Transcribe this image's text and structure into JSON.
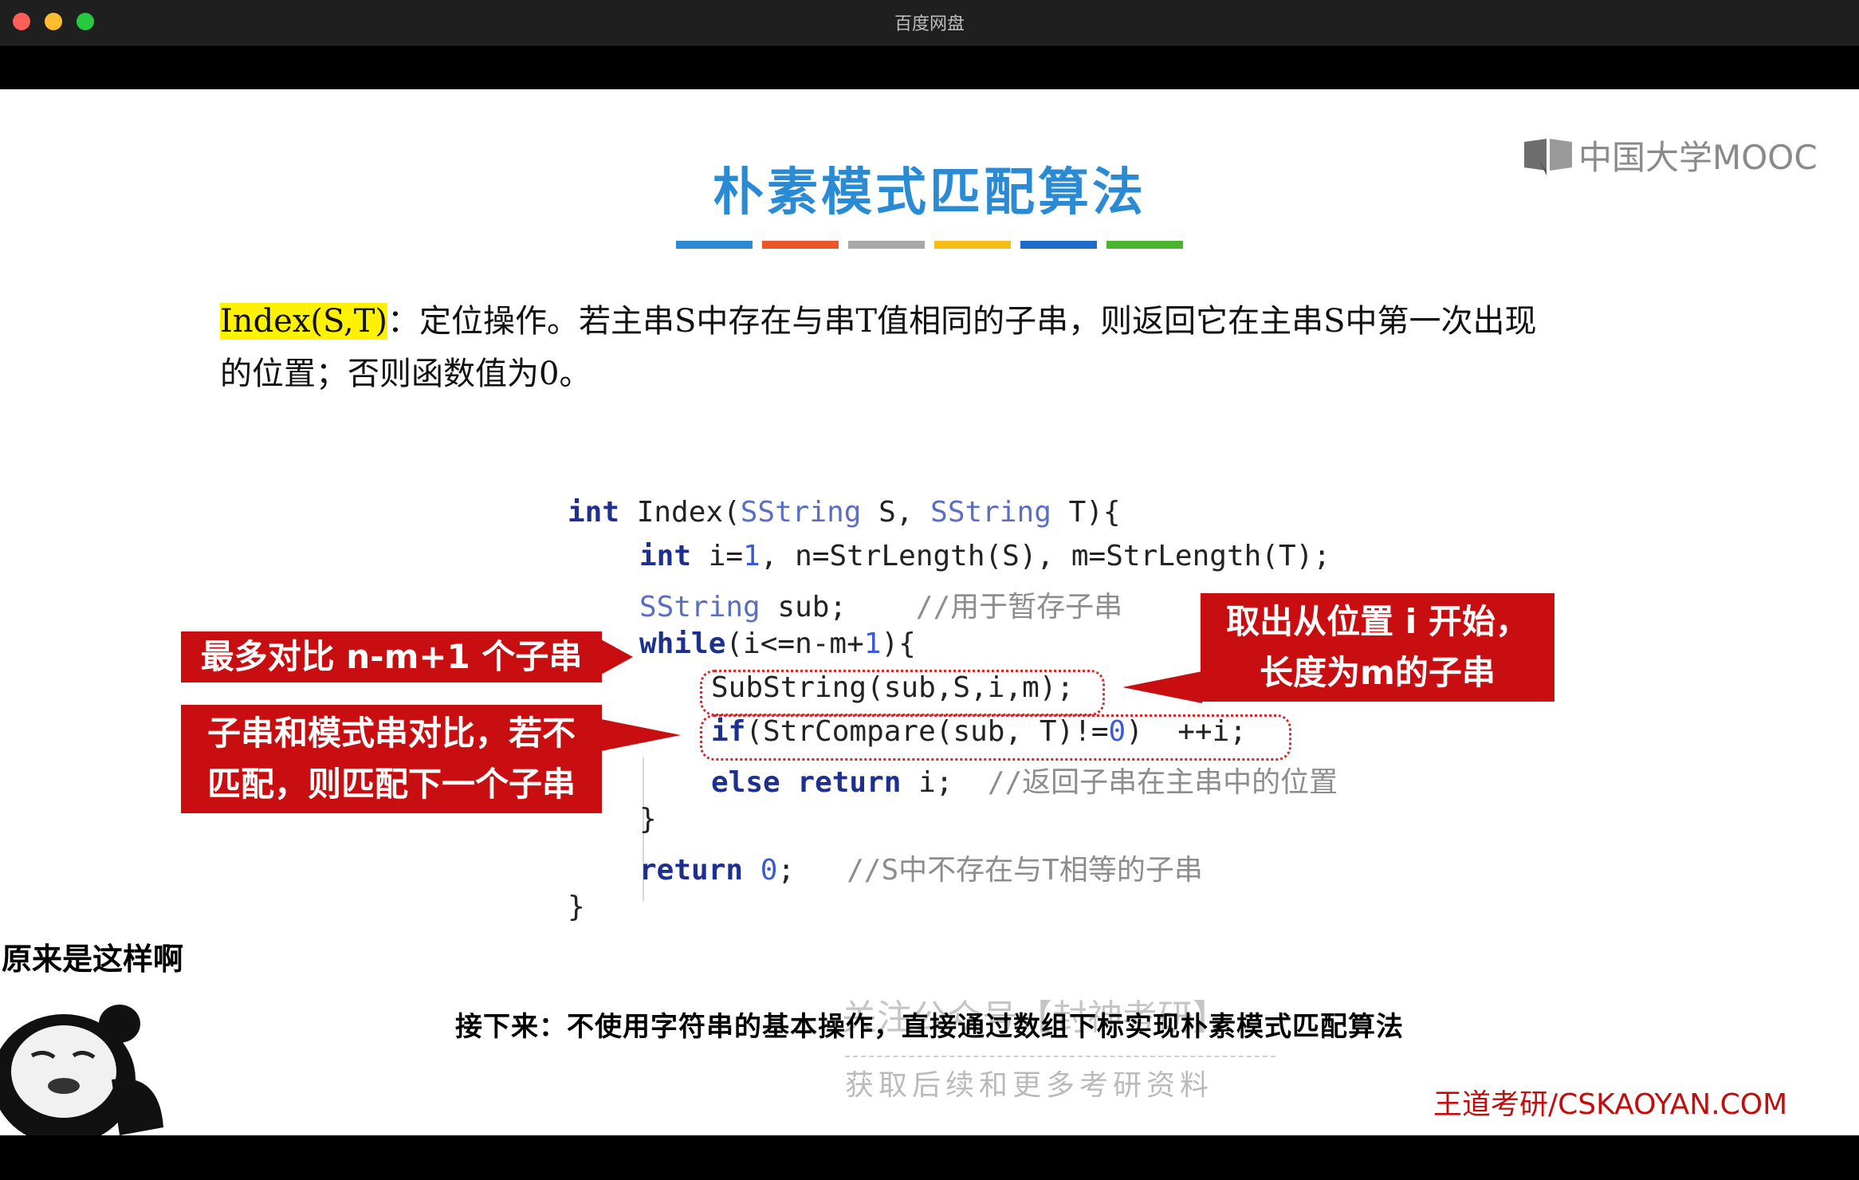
{
  "window": {
    "title": "百度网盘"
  },
  "slide": {
    "logo_text": "中国大学MOOC",
    "title": "朴素模式匹配算法",
    "underline_colors": [
      "#2c8ad5",
      "#e8562a",
      "#a8a8a8",
      "#f5bd17",
      "#1f6cc6",
      "#4bb32f"
    ],
    "description": {
      "term": "Index(S,T)",
      "text_line1": "：定位操作。若主串S中存在与串T值相同的子串，则返回它在主串S中第一次出现",
      "text_line2": "的位置；否则函数值为0。"
    },
    "code": {
      "l1_kw": "int",
      "l1_a": " Index(",
      "l1_t1": "SString",
      "l1_b": " S, ",
      "l1_t2": "SString",
      "l1_c": " T){",
      "l2_kw": "int",
      "l2_a": " i=",
      "l2_n": "1",
      "l2_b": ", n=StrLength(S), m=StrLength(T);",
      "l3_t": "SString",
      "l3_a": " sub;    ",
      "l3_c": "//用于暂存子串",
      "l4_kw": "while",
      "l4_a": "(i<=n-m+",
      "l4_n": "1",
      "l4_b": "){",
      "l5": "SubString(sub,S,i,m);",
      "l6_kw": "if",
      "l6_a": "(StrCompare(sub, T)!=",
      "l6_n": "0",
      "l6_b": ")  ++i;",
      "l7_kw1": "else",
      "l7_kw2": "return",
      "l7_a": " i;  ",
      "l7_c": "//返回子串在主串中的位置",
      "l8": "}",
      "l9_kw": "return",
      "l9_n": "0",
      "l9_a": ";   ",
      "l9_c": "//S中不存在与T相等的子串",
      "l10": "}"
    },
    "callouts": {
      "loop": "最多对比 n-m+1 个子串",
      "substring_line1": "取出从位置 i 开始，",
      "substring_line2": "长度为m的子串",
      "compare_line1": "子串和模式串对比，若不",
      "compare_line2": "匹配，则匹配下一个子串"
    },
    "meme_text": "原来是这样啊",
    "subtitle": "接下来：不使用字符串的基本操作，直接通过数组下标实现朴素模式匹配算法",
    "watermark_line1": "关注公众号【封神考研】",
    "watermark_line2": "获取后续和更多考研资料",
    "footer_brand": "王道考研/CSKAOYAN.COM"
  }
}
